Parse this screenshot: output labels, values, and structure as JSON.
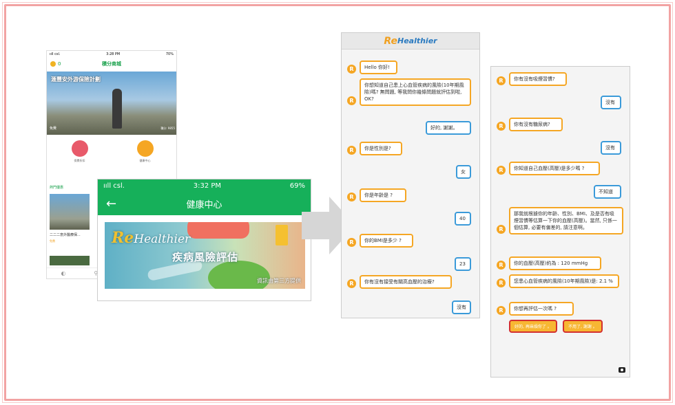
{
  "phone1": {
    "status_time": "3:28 PM",
    "carrier": "ııll csl.",
    "battery": "70%",
    "points": "0",
    "title": "積分商城",
    "hero_text": "滙豐安外游保險計劃",
    "hero_tag": "免費",
    "hero_right": "積分: 9855",
    "icon1_label": "保費折扣",
    "icon2_label": "健康中心",
    "section_title": "熱門優惠",
    "thumb_caption": "二二二意外醫療保...",
    "thumb_tag": "免費"
  },
  "phone2": {
    "carrier": "ııll csl.",
    "status_time": "3:32 PM",
    "battery": "69%",
    "back": "←",
    "title": "健康中心",
    "logo_prefix": "Re",
    "logo_main": "Healthier",
    "subtitle": "疾病風險評估",
    "footer": "資訊由第三方提供"
  },
  "chatA": {
    "logo_prefix": "Re",
    "logo_main": "Healthier",
    "messages": [
      {
        "role": "bot",
        "text": "Hello 你好!"
      },
      {
        "role": "bot",
        "text": "你想知道自己患上心血管疾病的風險(10年期風險)嗎? 無問題, 等我問你幾條問題就評估到啦, OK?"
      },
      {
        "role": "user",
        "text": "好的, 謝謝。"
      },
      {
        "role": "bot",
        "text": "你是性別是?"
      },
      {
        "role": "user",
        "text": "女"
      },
      {
        "role": "bot",
        "text": "你是年齡是 ?"
      },
      {
        "role": "user",
        "text": "40"
      },
      {
        "role": "bot",
        "text": "你的BMI是多少 ?"
      },
      {
        "role": "user",
        "text": "23"
      },
      {
        "role": "bot",
        "text": "你有沒有接受有關高血壓的治療?"
      },
      {
        "role": "user",
        "text": "沒有"
      }
    ]
  },
  "chatB": {
    "messages": [
      {
        "role": "bot",
        "text": "你有沒有吸煙習慣?"
      },
      {
        "role": "user",
        "text": "沒有"
      },
      {
        "role": "bot",
        "text": "你有沒有糖尿病?"
      },
      {
        "role": "user",
        "text": "沒有"
      },
      {
        "role": "bot",
        "text": "你知道自己血壓(高壓)是多少嗎 ?"
      },
      {
        "role": "user",
        "text": "不知道"
      },
      {
        "role": "bot",
        "text": "那我就根據你的年齡、性別、BMI、及是否有吸煙習慣等估算一下你的血壓(高壓)。當然, 只係一個估算, 必要有偏差的, 請注意啊。"
      },
      {
        "role": "bot",
        "text": "你的血壓(高壓)約為 : 120 mmHg"
      },
      {
        "role": "bot",
        "text": "您患心血管疾病的風險(10年期風險)是: 2.1 %"
      },
      {
        "role": "bot",
        "text": "你想再評估一次嗎 ?"
      }
    ],
    "quick_replies": [
      "好的, 再麻煩你了 。",
      "不用了, 謝謝 。"
    ]
  },
  "icons": {
    "bot_avatar": "R",
    "camera": "camera-icon"
  },
  "colors": {
    "green": "#16b05a",
    "bot_border": "#f5a623",
    "user_border": "#3a9ad9",
    "frame": "#f2a3a3"
  }
}
